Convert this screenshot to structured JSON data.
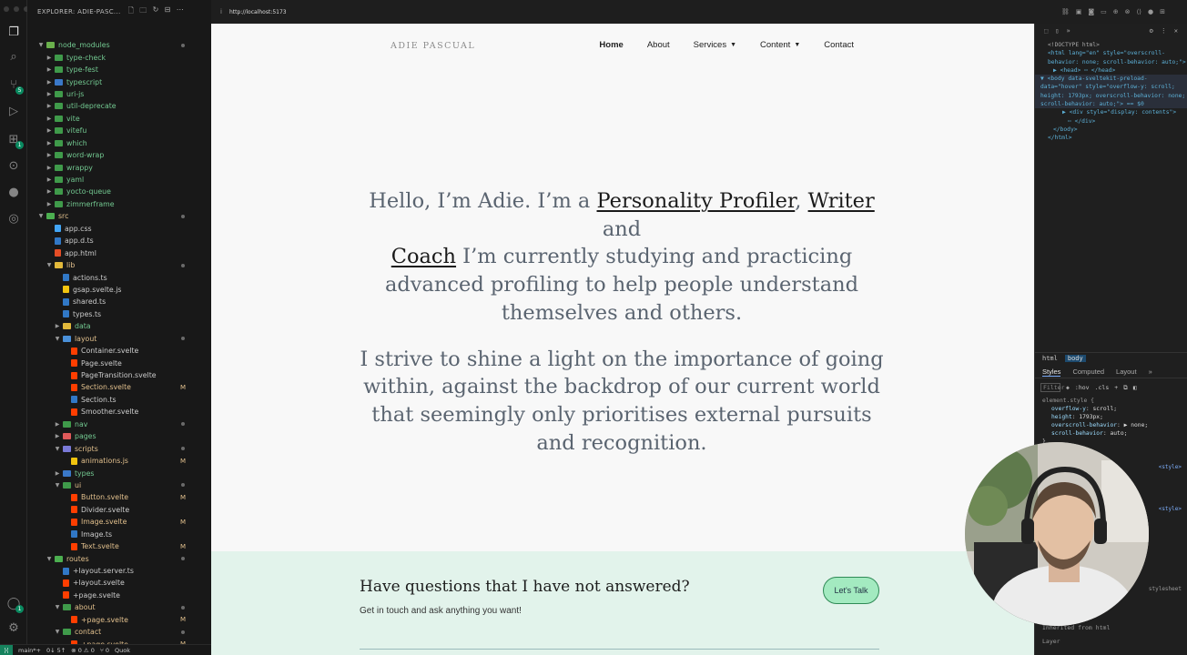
{
  "window": {
    "title": "EXPLORER: ADIE-PASC..."
  },
  "explorer": {
    "title": "EXPLORER: ADIE-PASC...",
    "rows": [
      {
        "label": "node_modules",
        "indent": 1,
        "open": true,
        "kind": "folder-node",
        "mark": "dot"
      },
      {
        "label": "type-check",
        "indent": 2,
        "kind": "folder"
      },
      {
        "label": "type-fest",
        "indent": 2,
        "kind": "folder"
      },
      {
        "label": "typescript",
        "indent": 2,
        "kind": "folder-blue"
      },
      {
        "label": "uri-js",
        "indent": 2,
        "kind": "folder"
      },
      {
        "label": "util-deprecate",
        "indent": 2,
        "kind": "folder"
      },
      {
        "label": "vite",
        "indent": 2,
        "kind": "folder"
      },
      {
        "label": "vitefu",
        "indent": 2,
        "kind": "folder"
      },
      {
        "label": "which",
        "indent": 2,
        "kind": "folder"
      },
      {
        "label": "word-wrap",
        "indent": 2,
        "kind": "folder"
      },
      {
        "label": "wrappy",
        "indent": 2,
        "kind": "folder"
      },
      {
        "label": "yaml",
        "indent": 2,
        "kind": "folder"
      },
      {
        "label": "yocto-queue",
        "indent": 2,
        "kind": "folder"
      },
      {
        "label": "zimmerframe",
        "indent": 2,
        "kind": "folder"
      },
      {
        "label": "src",
        "indent": 1,
        "open": true,
        "kind": "folder-src",
        "mark": "dot",
        "color": "yellow"
      },
      {
        "label": "app.css",
        "indent": 2,
        "kind": "file-css"
      },
      {
        "label": "app.d.ts",
        "indent": 2,
        "kind": "file-ts"
      },
      {
        "label": "app.html",
        "indent": 2,
        "kind": "file-html"
      },
      {
        "label": "lib",
        "indent": 2,
        "open": true,
        "kind": "folder-lib",
        "mark": "dot",
        "color": "yellow"
      },
      {
        "label": "actions.ts",
        "indent": 3,
        "kind": "file-ts"
      },
      {
        "label": "gsap.svelte.js",
        "indent": 3,
        "kind": "file-js"
      },
      {
        "label": "shared.ts",
        "indent": 3,
        "kind": "file-ts"
      },
      {
        "label": "types.ts",
        "indent": 3,
        "kind": "file-ts"
      },
      {
        "label": "data",
        "indent": 3,
        "kind": "folder-data"
      },
      {
        "label": "layout",
        "indent": 3,
        "open": true,
        "kind": "folder-layout",
        "mark": "dot",
        "color": "yellow"
      },
      {
        "label": "Container.svelte",
        "indent": 4,
        "kind": "file-svelte"
      },
      {
        "label": "Page.svelte",
        "indent": 4,
        "kind": "file-svelte"
      },
      {
        "label": "PageTransition.svelte",
        "indent": 4,
        "kind": "file-svelte"
      },
      {
        "label": "Section.svelte",
        "indent": 4,
        "kind": "file-svelte",
        "mark": "M",
        "color": "yellow"
      },
      {
        "label": "Section.ts",
        "indent": 4,
        "kind": "file-ts"
      },
      {
        "label": "Smoother.svelte",
        "indent": 4,
        "kind": "file-svelte"
      },
      {
        "label": "nav",
        "indent": 3,
        "kind": "folder",
        "mark": "dot"
      },
      {
        "label": "pages",
        "indent": 3,
        "kind": "folder-pages"
      },
      {
        "label": "scripts",
        "indent": 3,
        "open": true,
        "kind": "folder-scripts",
        "mark": "dot",
        "color": "yellow"
      },
      {
        "label": "animations.js",
        "indent": 4,
        "kind": "file-js",
        "mark": "M",
        "color": "yellow"
      },
      {
        "label": "types",
        "indent": 3,
        "kind": "folder-blue"
      },
      {
        "label": "ui",
        "indent": 3,
        "open": true,
        "kind": "folder",
        "mark": "dot",
        "color": "yellow"
      },
      {
        "label": "Button.svelte",
        "indent": 4,
        "kind": "file-svelte",
        "mark": "M",
        "color": "yellow"
      },
      {
        "label": "Divider.svelte",
        "indent": 4,
        "kind": "file-svelte"
      },
      {
        "label": "Image.svelte",
        "indent": 4,
        "kind": "file-svelte",
        "mark": "M",
        "color": "yellow"
      },
      {
        "label": "Image.ts",
        "indent": 4,
        "kind": "file-ts"
      },
      {
        "label": "Text.svelte",
        "indent": 4,
        "kind": "file-svelte",
        "mark": "M",
        "color": "yellow"
      },
      {
        "label": "routes",
        "indent": 2,
        "open": true,
        "kind": "folder-routes",
        "mark": "dot",
        "color": "yellow"
      },
      {
        "label": "+layout.server.ts",
        "indent": 3,
        "kind": "file-ts"
      },
      {
        "label": "+layout.svelte",
        "indent": 3,
        "kind": "file-svelte"
      },
      {
        "label": "+page.svelte",
        "indent": 3,
        "kind": "file-svelte"
      },
      {
        "label": "about",
        "indent": 3,
        "open": true,
        "kind": "folder",
        "mark": "dot",
        "color": "yellow"
      },
      {
        "label": "+page.svelte",
        "indent": 4,
        "kind": "file-svelte",
        "mark": "M",
        "color": "yellow"
      },
      {
        "label": "contact",
        "indent": 3,
        "open": true,
        "kind": "folder",
        "mark": "dot",
        "color": "yellow"
      },
      {
        "label": "+page.svelte",
        "indent": 4,
        "kind": "file-svelte",
        "mark": "M",
        "color": "yellow"
      }
    ]
  },
  "statusbar": {
    "branch": "main*+",
    "sync": "0↓ 5↑",
    "errors": "0",
    "warnings": "0",
    "ports": "0",
    "quick": "Quok"
  },
  "browser": {
    "url": "http://localhost:5173"
  },
  "site": {
    "logo": "ADIE PASCUAL",
    "nav": {
      "home": "Home",
      "about": "About",
      "services": "Services",
      "content": "Content",
      "contact": "Contact"
    },
    "hero": {
      "p1_a": "Hello, I’m Adie. I’m a ",
      "link1": "Personality Profiler",
      "p1_b": ", ",
      "link2": "Writer",
      "p1_c": " and ",
      "link3": "Coach",
      "p1_d": " I’m currently studying and practicing advanced profiling to help people understand themselves and others.",
      "p2": "I strive to shine a light on the importance of going within, against the backdrop of our current world that seemingly only prioritises external pursuits and recognition."
    },
    "cta": {
      "title": "Have questions that I have not answered?",
      "subtitle": "Get in touch and ask anything you want!",
      "button": "Let's Talk"
    }
  },
  "devtools": {
    "dom": [
      "<!DOCTYPE html>",
      "<html lang=\"en\" style=\"overscroll-behavior: none; scroll-behavior: auto;\">",
      "▶ <head> ⋯ </head>",
      "▼ <body data-sveltekit-preload-data=\"hover\" style=\"overflow-y: scroll; height: 1793px; overscroll-behavior: none; scroll-behavior: auto;\"> == $0",
      "▶ <div style=\"display: contents\">",
      "⋯ </div>",
      "</body>",
      "</html>"
    ],
    "crumbs": [
      "html",
      "body"
    ],
    "tabs": [
      "Styles",
      "Computed",
      "Layout",
      "»"
    ],
    "filter": "Filter",
    "hov": ":hov",
    "cls": ".cls",
    "element_style": "element.style {",
    "props": [
      {
        "name": "overflow-y",
        "value": "scroll;"
      },
      {
        "name": "height",
        "value": "1793px;"
      },
      {
        "name": "overscroll-behavior",
        "value": "▶ none;"
      },
      {
        "name": "scroll-behavior",
        "value": "auto;"
      }
    ],
    "close_brace": "}",
    "style_link1": "<style>",
    "style_link2": "<style>",
    "stylesheet": "stylesheet",
    "inherited": "Inherited from html",
    "layer": "Layer"
  },
  "colors": {
    "accent": "#a3eac0",
    "cta_bg": "#e2f3eb",
    "hero_text": "#5a6470"
  }
}
